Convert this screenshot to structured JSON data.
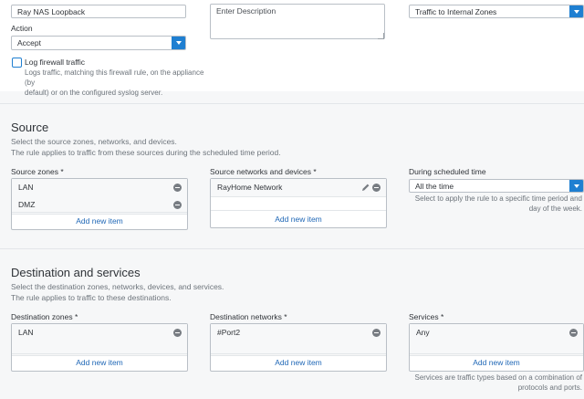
{
  "rule_name": {
    "value": "Ray NAS Loopback"
  },
  "description": {
    "placeholder": "Enter Description"
  },
  "rule_position": {
    "value": "Traffic to Internal Zones"
  },
  "action": {
    "label": "Action",
    "value": "Accept"
  },
  "log": {
    "label": "Log firewall traffic",
    "desc_line1": "Logs traffic, matching this firewall rule, on the appliance (by",
    "desc_line2": "default) or on the configured syslog server."
  },
  "source": {
    "heading": "Source",
    "sub_line1": "Select the source zones, networks, and devices.",
    "sub_line2": "The rule applies to traffic from these sources during the scheduled time period.",
    "zones_label": "Source zones",
    "zones": [
      "LAN",
      "DMZ"
    ],
    "networks_label": "Source networks and devices",
    "networks": [
      "RayHome Network"
    ],
    "schedule_label": "During scheduled time",
    "schedule_value": "All the time",
    "schedule_help_line1": "Select to apply the rule to a specific time period and",
    "schedule_help_line2": "day of the week.",
    "add_new": "Add new item"
  },
  "destination": {
    "heading": "Destination and services",
    "sub_line1": "Select the destination zones, networks, devices, and services.",
    "sub_line2": "The rule applies to traffic to these destinations.",
    "zones_label": "Destination zones",
    "zones": [
      "LAN"
    ],
    "networks_label": "Destination networks",
    "networks": [
      "#Port2"
    ],
    "services_label": "Services",
    "services": [
      "Any"
    ],
    "services_help_line1": "Services are traffic types based on a combination of",
    "services_help_line2": "protocols and ports.",
    "add_new": "Add new item"
  },
  "required_mark": "*",
  "colors": {
    "accent": "#1f7fd1",
    "link": "#1f67b6"
  }
}
